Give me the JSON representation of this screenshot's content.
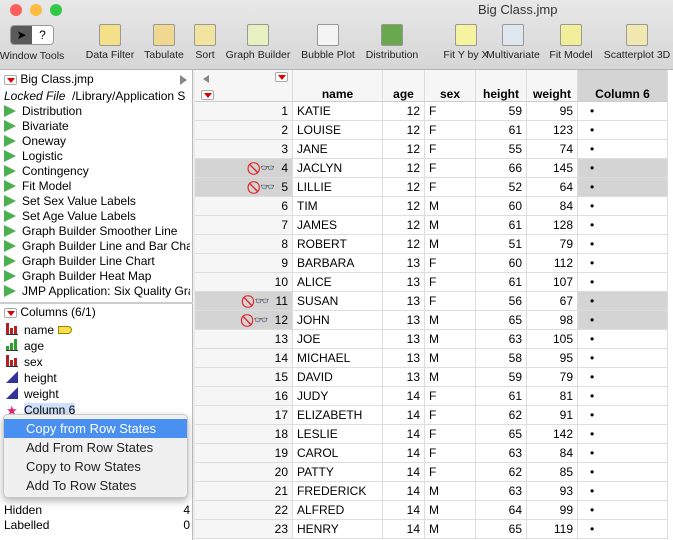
{
  "window": {
    "title": "Big Class.jmp"
  },
  "toolbar": [
    {
      "label": "Window Tools",
      "icon": "arrow-help-icon"
    },
    {
      "label": "Data Filter",
      "icon": "data-filter-icon"
    },
    {
      "label": "Tabulate",
      "icon": "tabulate-icon"
    },
    {
      "label": "Sort",
      "icon": "sort-icon"
    },
    {
      "label": "Graph Builder",
      "icon": "graph-builder-icon"
    },
    {
      "label": "Bubble Plot",
      "icon": "bubble-plot-icon"
    },
    {
      "label": "Distribution",
      "icon": "distribution-icon"
    },
    {
      "label": "Fit Y by X",
      "icon": "fit-y-by-x-icon"
    },
    {
      "label": "Multivariate",
      "icon": "multivariate-icon"
    },
    {
      "label": "Fit Model",
      "icon": "fit-model-icon"
    },
    {
      "label": "Scatterplot 3D",
      "icon": "scatterplot-3d-icon"
    }
  ],
  "table_panel": {
    "title": "Big Class.jmp",
    "locked": "Locked File",
    "path": "/Library/Application S",
    "scripts": [
      "Distribution",
      "Bivariate",
      "Oneway",
      "Logistic",
      "Contingency",
      "Fit Model",
      "Set Sex Value Labels",
      "Set Age Value Labels",
      "Graph Builder Smoother Line",
      "Graph Builder Line and Bar Cha",
      "Graph Builder Line Chart",
      "Graph Builder Heat Map",
      "JMP Application: Six Quality Gra"
    ]
  },
  "columns_panel": {
    "title": "Columns (6/1)",
    "items": [
      {
        "name": "name",
        "type": "nominal",
        "color": "#b22222"
      },
      {
        "name": "age",
        "type": "ordinal",
        "color": "#2e9e2e"
      },
      {
        "name": "sex",
        "type": "nominal",
        "color": "#b22222"
      },
      {
        "name": "height",
        "type": "continuous",
        "color": "#333399"
      },
      {
        "name": "weight",
        "type": "continuous",
        "color": "#333399"
      },
      {
        "name": "Column 6",
        "type": "row-state",
        "color": "#e0207a"
      }
    ]
  },
  "rows_panel": [
    {
      "label": "Hidden",
      "value": "4"
    },
    {
      "label": "Labelled",
      "value": "0"
    }
  ],
  "context_menu": [
    "Copy from Row States",
    "Add From Row States",
    "Copy to Row States",
    "Add To Row States"
  ],
  "grid": {
    "headers": [
      "name",
      "age",
      "sex",
      "height",
      "weight",
      "Column 6"
    ],
    "rows": [
      [
        "1",
        "KATIE",
        "12",
        "F",
        "59",
        "95",
        "•",
        false
      ],
      [
        "2",
        "LOUISE",
        "12",
        "F",
        "61",
        "123",
        "•",
        false
      ],
      [
        "3",
        "JANE",
        "12",
        "F",
        "55",
        "74",
        "•",
        false
      ],
      [
        "4",
        "JACLYN",
        "12",
        "F",
        "66",
        "145",
        "•",
        true
      ],
      [
        "5",
        "LILLIE",
        "12",
        "F",
        "52",
        "64",
        "•",
        true
      ],
      [
        "6",
        "TIM",
        "12",
        "M",
        "60",
        "84",
        "•",
        false
      ],
      [
        "7",
        "JAMES",
        "12",
        "M",
        "61",
        "128",
        "•",
        false
      ],
      [
        "8",
        "ROBERT",
        "12",
        "M",
        "51",
        "79",
        "•",
        false
      ],
      [
        "9",
        "BARBARA",
        "13",
        "F",
        "60",
        "112",
        "•",
        false
      ],
      [
        "10",
        "ALICE",
        "13",
        "F",
        "61",
        "107",
        "•",
        false
      ],
      [
        "11",
        "SUSAN",
        "13",
        "F",
        "56",
        "67",
        "•",
        true
      ],
      [
        "12",
        "JOHN",
        "13",
        "M",
        "65",
        "98",
        "•",
        true
      ],
      [
        "13",
        "JOE",
        "13",
        "M",
        "63",
        "105",
        "•",
        false
      ],
      [
        "14",
        "MICHAEL",
        "13",
        "M",
        "58",
        "95",
        "•",
        false
      ],
      [
        "15",
        "DAVID",
        "13",
        "M",
        "59",
        "79",
        "•",
        false
      ],
      [
        "16",
        "JUDY",
        "14",
        "F",
        "61",
        "81",
        "•",
        false
      ],
      [
        "17",
        "ELIZABETH",
        "14",
        "F",
        "62",
        "91",
        "•",
        false
      ],
      [
        "18",
        "LESLIE",
        "14",
        "F",
        "65",
        "142",
        "•",
        false
      ],
      [
        "19",
        "CAROL",
        "14",
        "F",
        "63",
        "84",
        "•",
        false
      ],
      [
        "20",
        "PATTY",
        "14",
        "F",
        "62",
        "85",
        "•",
        false
      ],
      [
        "21",
        "FREDERICK",
        "14",
        "M",
        "63",
        "93",
        "•",
        false
      ],
      [
        "22",
        "ALFRED",
        "14",
        "M",
        "64",
        "99",
        "•",
        false
      ],
      [
        "23",
        "HENRY",
        "14",
        "M",
        "65",
        "119",
        "•",
        false
      ]
    ]
  }
}
